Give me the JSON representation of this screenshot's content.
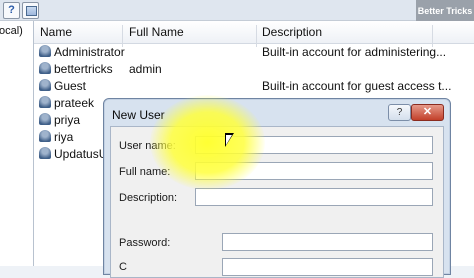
{
  "toolbar": {
    "help_icon": "?",
    "view_icon": "grid-icon"
  },
  "watermark": "Better Tricks",
  "tree": {
    "item_text": "ocal)"
  },
  "columns": {
    "name": "Name",
    "full_name": "Full Name",
    "description": "Description"
  },
  "users": [
    {
      "name": "Administrator",
      "full_name": "",
      "description": "Built-in account for administering..."
    },
    {
      "name": "bettertricks",
      "full_name": "admin",
      "description": ""
    },
    {
      "name": "Guest",
      "full_name": "",
      "description": "Built-in account for guest access t..."
    },
    {
      "name": "prateek",
      "full_name": "",
      "description": ""
    },
    {
      "name": "priya",
      "full_name": "",
      "description": ""
    },
    {
      "name": "riya",
      "full_name": "",
      "description": ""
    },
    {
      "name": "UpdatusU",
      "full_name": "",
      "description": ""
    }
  ],
  "dialog": {
    "title": "New User",
    "help_label": "?",
    "close_label": "✕",
    "fields": {
      "username_label": "User name:",
      "username_value": "",
      "fullname_label": "Full name:",
      "fullname_value": "",
      "description_label": "Description:",
      "description_value": "",
      "password_label": "Password:",
      "password_value": "",
      "confirm_label_partial": "C"
    }
  }
}
